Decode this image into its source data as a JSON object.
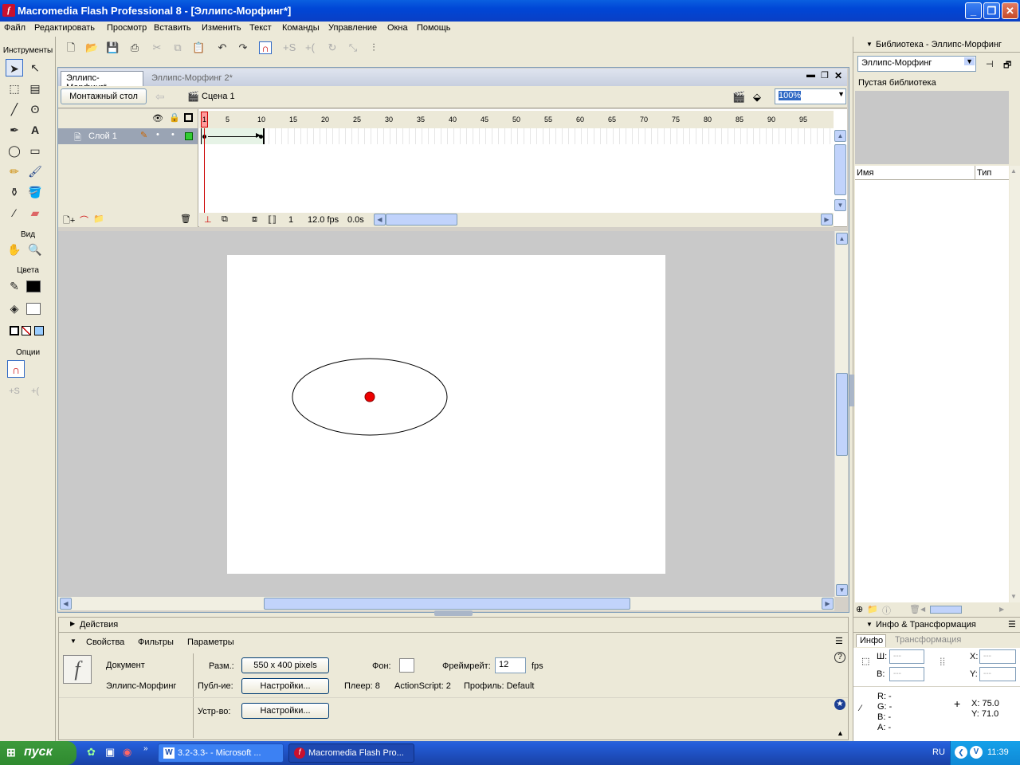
{
  "window": {
    "title": "Macromedia Flash Professional 8 - [Эллипс-Морфинг*]",
    "min": "_",
    "max": "❐",
    "close": "✕"
  },
  "menu": [
    "Файл",
    "Редактировать",
    "Просмотр",
    "Вставить",
    "Изменить",
    "Текст",
    "Команды",
    "Управление",
    "Окна",
    "Помощь"
  ],
  "tools": {
    "title": "Инструменты",
    "view": "Вид",
    "colors": "Цвета",
    "options": "Опции"
  },
  "doc": {
    "tabs": [
      "Эллипс-Морфинг*",
      "Эллипс-Морфинг 2*"
    ],
    "stage_button": "Монтажный стол",
    "scene": "Сцена 1",
    "zoom": "100%"
  },
  "timeline": {
    "ruler": [
      "1",
      "5",
      "10",
      "15",
      "20",
      "25",
      "30",
      "35",
      "40",
      "45",
      "50",
      "55",
      "60",
      "65",
      "70",
      "75",
      "80",
      "85",
      "90",
      "95"
    ],
    "layer": "Слой 1",
    "frame": "1",
    "fps": "12.0 fps",
    "time": "0.0s"
  },
  "properties": {
    "panel_actions": "Действия",
    "tabs": [
      "Свойства",
      "Фильтры",
      "Параметры"
    ],
    "doc_label": "Документ",
    "doc_name": "Эллипс-Морфинг",
    "size_label": "Разм.:",
    "size_value": "550 x 400 pixels",
    "bg_label": "Фон:",
    "fps_label": "Фреймрейт:",
    "fps_value": "12",
    "fps_unit": "fps",
    "publish_label": "Публ-ие:",
    "publish_btn": "Настройки...",
    "player": "Плеер: 8",
    "actionscript": "ActionScript:  2",
    "profile": "Профиль: Default",
    "device_label": "Устр-во:",
    "device_btn": "Настройки..."
  },
  "library": {
    "title": "Библиотека - Эллипс-Морфинг",
    "selected": "Эллипс-Морфинг",
    "empty": "Пустая библиотека",
    "col_name": "Имя",
    "col_type": "Тип"
  },
  "info": {
    "title": "Инфо & Трансформация",
    "tabs": [
      "Инфо",
      "Трансформация"
    ],
    "w_label": "Ш:",
    "h_label": "В:",
    "x_label": "X:",
    "y_label": "Y:",
    "dash": "---",
    "r": "R: -",
    "g": "G: -",
    "b": "B: -",
    "a": "A: -",
    "cx": "X: 75.0",
    "cy": "Y: 71.0"
  },
  "taskbar": {
    "start": "пуск",
    "task1": "3.2-3.3- - Microsoft ...",
    "task2": "Macromedia Flash Pro...",
    "lang": "RU",
    "clock": "11:39"
  }
}
